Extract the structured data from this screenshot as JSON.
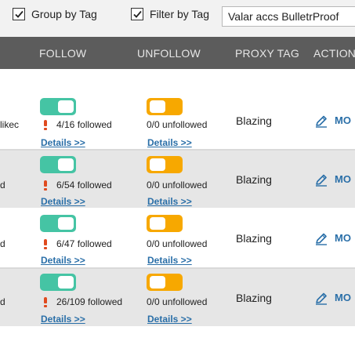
{
  "filters": {
    "group_by_tag": {
      "label": "Group by Tag",
      "checked": true
    },
    "filter_by_tag": {
      "label": "Filter by Tag",
      "checked": true
    },
    "tag_select": {
      "value": "Valar accs BulletrProof"
    }
  },
  "table": {
    "headers": {
      "follow": "FOLLOW",
      "unfollow": "UNFOLLOW",
      "proxy_tag": "PROXY TAG",
      "actions": "ACTIONS"
    },
    "rows": [
      {
        "name_fragment": "likec",
        "follow_toggle": "on",
        "follow_count": "4/16 followed",
        "follow_warning": true,
        "follow_details": "Details >>",
        "unfollow_toggle": "off",
        "unfollow_count": "0/0 unfollowed",
        "unfollow_details": "Details >>",
        "proxy_tag": "Blazing",
        "action_label": "MO"
      },
      {
        "name_fragment": "d",
        "follow_toggle": "on",
        "follow_count": "6/54 followed",
        "follow_warning": true,
        "follow_details": "Details >>",
        "unfollow_toggle": "off",
        "unfollow_count": "0/0 unfollowed",
        "unfollow_details": "Details >>",
        "proxy_tag": "Blazing",
        "action_label": "MO"
      },
      {
        "name_fragment": "d",
        "follow_toggle": "on",
        "follow_count": "6/47 followed",
        "follow_warning": true,
        "follow_details": "Details >>",
        "unfollow_toggle": "off",
        "unfollow_count": "0/0 unfollowed",
        "unfollow_details": "Details >>",
        "proxy_tag": "Blazing",
        "action_label": "MO"
      },
      {
        "name_fragment": "d",
        "follow_toggle": "on",
        "follow_count": "26/109 followed",
        "follow_warning": true,
        "follow_details": "Details >>",
        "unfollow_toggle": "off",
        "unfollow_count": "0/0 unfollowed",
        "unfollow_details": "Details >>",
        "proxy_tag": "Blazing",
        "action_label": "MO"
      }
    ]
  },
  "colors": {
    "toggle_on": "#45c4a4",
    "toggle_off": "#f7a800",
    "header_bg": "#5c5c5c",
    "link": "#2a6fa8",
    "warning": "#e04a1e"
  },
  "icons": {
    "checkbox": "check-icon",
    "warning": "exclamation-icon",
    "edit": "pencil-icon"
  }
}
